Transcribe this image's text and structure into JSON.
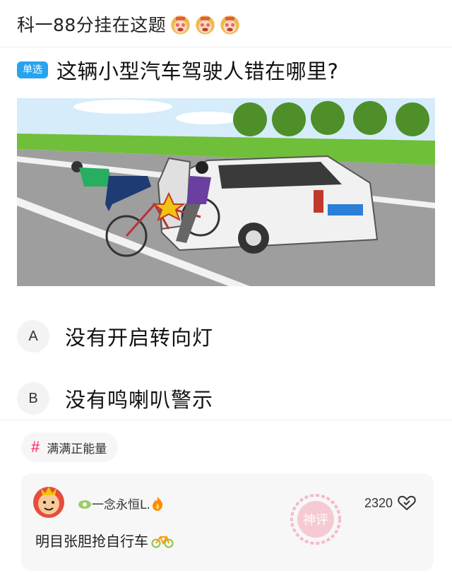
{
  "header": {
    "title": "科一88分挂在这题",
    "emojis": [
      "monkey-face-icon",
      "monkey-face-icon",
      "monkey-face-icon"
    ]
  },
  "question": {
    "type_badge": "单选",
    "text": "这辆小型汽车驾驶人错在哪里?"
  },
  "options": [
    {
      "letter": "A",
      "text": "没有开启转向灯"
    },
    {
      "letter": "B",
      "text": "没有鸣喇叭警示"
    }
  ],
  "topic": {
    "hash": "#",
    "label": "满满正能量"
  },
  "comment": {
    "username": "一念永恒L.",
    "likes": "2320",
    "text": "明目张胆抢自行车",
    "stamp_text": "神评"
  },
  "colors": {
    "badge": "#2aa3ef",
    "hash": "#ff4f7a",
    "grass": "#6fbf3a",
    "road": "#9e9e9e",
    "sky": "#d6ecfb"
  }
}
